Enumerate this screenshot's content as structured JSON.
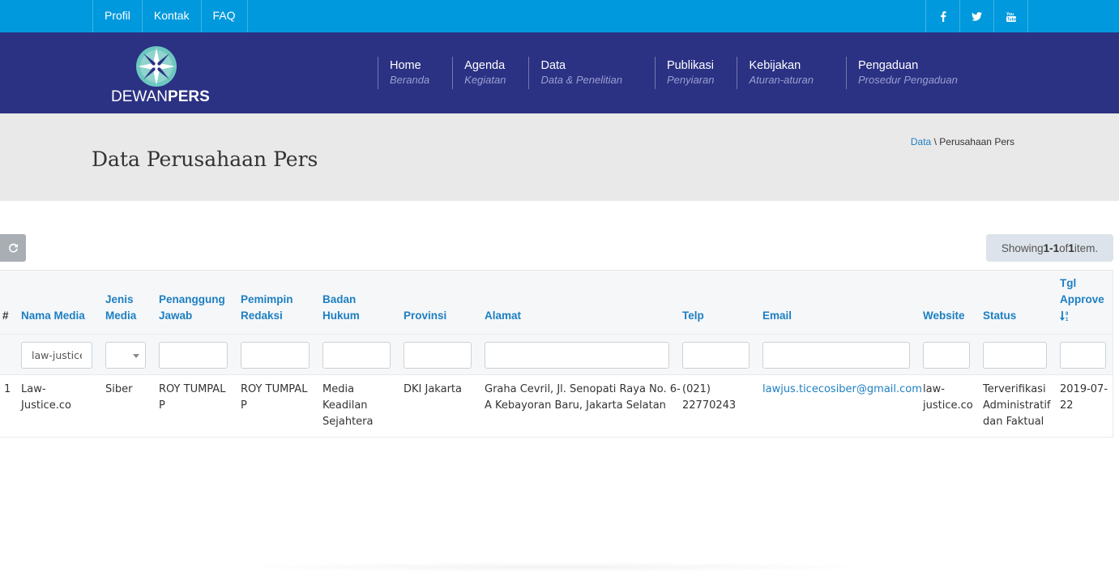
{
  "topbar": {
    "links": [
      "Profil",
      "Kontak",
      "FAQ"
    ],
    "social": [
      "facebook-icon",
      "twitter-icon",
      "youtube-icon"
    ]
  },
  "brand": {
    "word_light": "DEWAN",
    "word_bold": "PERS"
  },
  "nav": [
    {
      "title": "Home",
      "sub": "Beranda"
    },
    {
      "title": "Agenda",
      "sub": "Kegiatan"
    },
    {
      "title": "Data",
      "sub": "Data & Penelitian"
    },
    {
      "title": "Publikasi",
      "sub": "Penyiaran"
    },
    {
      "title": "Kebijakan",
      "sub": "Aturan-aturan"
    },
    {
      "title": "Pengaduan",
      "sub": "Prosedur Pengaduan"
    }
  ],
  "page": {
    "title": "Data Perusahaan Pers",
    "breadcrumb": {
      "link": "Data",
      "sep": "\\",
      "current": "Perusahaan Pers"
    }
  },
  "summary": {
    "prefix": "Showing ",
    "range": "1-1",
    "mid": " of ",
    "total": "1",
    "suffix": " item."
  },
  "table": {
    "headers": {
      "num": "#",
      "nama": "Nama Media",
      "jenis_1": "Jenis",
      "jenis_2": "Media",
      "penanggung_1": "Penanggung",
      "penanggung_2": "Jawab",
      "pemimpin_1": "Pemimpin",
      "pemimpin_2": "Redaksi",
      "badan_1": "Badan",
      "badan_2": "Hukum",
      "provinsi": "Provinsi",
      "alamat": "Alamat",
      "telp": "Telp",
      "email": "Email",
      "website": "Website",
      "status": "Status",
      "tgl_1": "Tgl",
      "tgl_2": "Approve"
    },
    "filters": {
      "nama": "law-justice"
    },
    "row": {
      "num": "1",
      "nama_1": "Law-",
      "nama_2": "Justice.co",
      "jenis": "Siber",
      "penanggung_1": "ROY TUMPAL",
      "penanggung_2": "P",
      "pemimpin_1": "ROY TUMPAL",
      "pemimpin_2": "P",
      "badan_1": "Media",
      "badan_2": "Keadilan",
      "badan_3": "Sejahtera",
      "provinsi": "DKI Jakarta",
      "alamat_1": "Graha Cevril, Jl. Senopati Raya No. 6-",
      "alamat_2": "A Kebayoran Baru, Jakarta Selatan",
      "telp_1": "(021)",
      "telp_2": "22770243",
      "email": "lawjus.ticecosiber@gmail.com",
      "website_1": "law-",
      "website_2": "justice.co",
      "status_1": "Terverifikasi",
      "status_2": "Administratif",
      "status_3": "dan Faktual",
      "tgl_1": "2019-07-",
      "tgl_2": "22"
    }
  },
  "colors": {
    "topbar": "#0099dd",
    "header": "#2b3183",
    "link": "#1d7fc1",
    "band": "#e9e9e9"
  }
}
